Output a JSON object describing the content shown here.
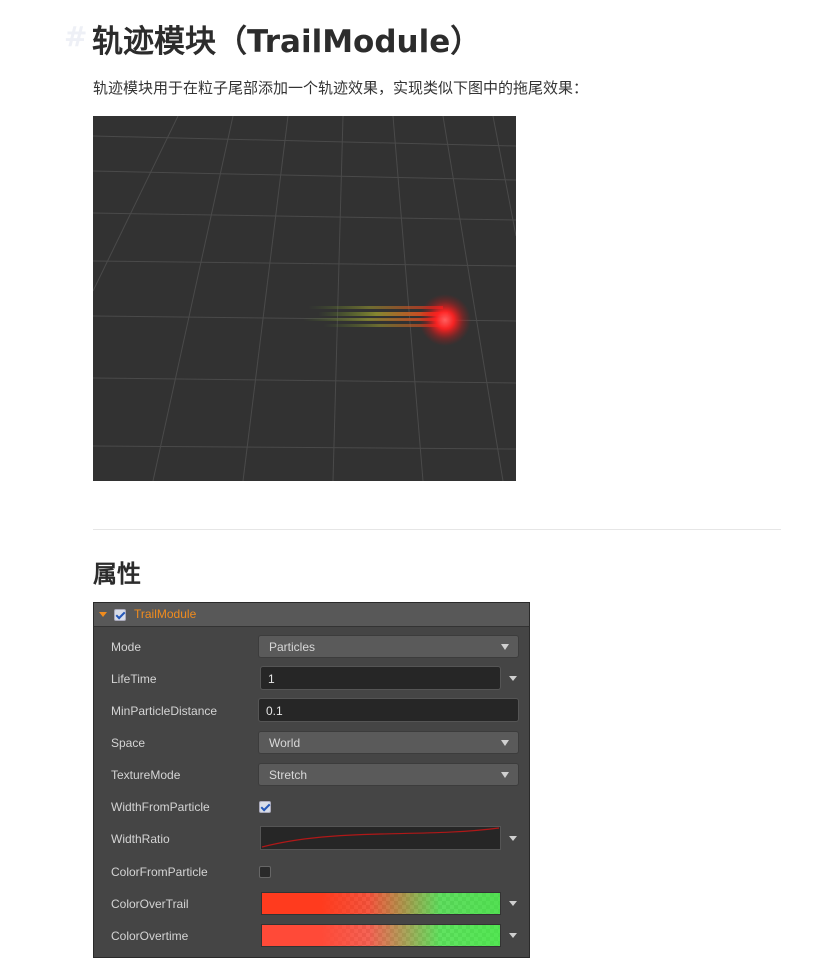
{
  "heading": {
    "anchor": "#",
    "title": "轨迹模块（TrailModule）"
  },
  "intro": "轨迹模块用于在粒子尾部添加一个轨迹效果，实现类似下图中的拖尾效果：",
  "section_title": "属性",
  "panel": {
    "title": "TrailModule",
    "enabled": true,
    "accent_color": "#f08c1e",
    "rows": {
      "mode": {
        "label": "Mode",
        "value": "Particles"
      },
      "lifetime": {
        "label": "LifeTime",
        "value": "1"
      },
      "min_particle_distance": {
        "label": "MinParticleDistance",
        "value": "0.1"
      },
      "space": {
        "label": "Space",
        "value": "World"
      },
      "texture_mode": {
        "label": "TextureMode",
        "value": "Stretch"
      },
      "width_from_particle": {
        "label": "WidthFromParticle",
        "checked": true
      },
      "width_ratio": {
        "label": "WidthRatio"
      },
      "color_from_particle": {
        "label": "ColorFromParticle",
        "checked": false
      },
      "color_over_trail": {
        "label": "ColorOverTrail",
        "colors": [
          "#ff3b1e",
          "#46e246"
        ]
      },
      "color_overtime": {
        "label": "ColorOvertime",
        "colors": [
          "#ff4a38",
          "#46e846"
        ]
      }
    }
  }
}
